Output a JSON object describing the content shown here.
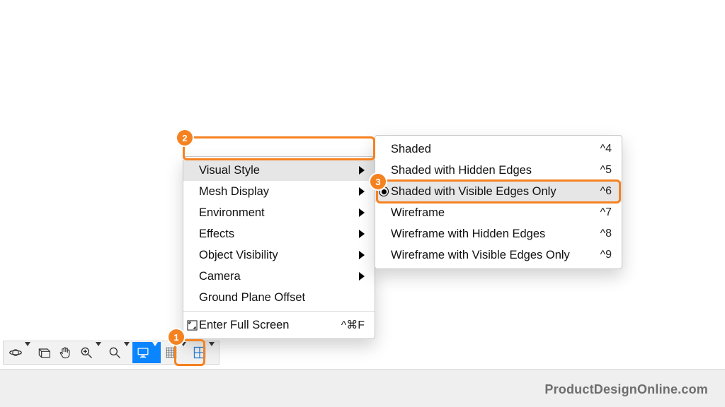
{
  "annotations": {
    "badge1": "1",
    "badge2": "2",
    "badge3": "3"
  },
  "toolbar": {
    "items": [
      {
        "name": "orbit-tool",
        "dropdown": true
      },
      {
        "name": "look-at-tool",
        "dropdown": false
      },
      {
        "name": "pan-tool",
        "dropdown": false
      },
      {
        "name": "zoom-tool",
        "dropdown": true
      },
      {
        "name": "fit-tool",
        "dropdown": true
      },
      {
        "name": "display-settings-tool",
        "dropdown": true,
        "selected": true
      },
      {
        "name": "grid-tool",
        "dropdown": true
      },
      {
        "name": "viewports-tool",
        "dropdown": true
      }
    ]
  },
  "menu": {
    "items": [
      {
        "label": "Visual Style",
        "submenu": true,
        "hover": true
      },
      {
        "label": "Mesh Display",
        "submenu": true
      },
      {
        "label": "Environment",
        "submenu": true
      },
      {
        "label": "Effects",
        "submenu": true
      },
      {
        "label": "Object Visibility",
        "submenu": true
      },
      {
        "label": "Camera",
        "submenu": true
      },
      {
        "label": "Ground Plane Offset",
        "submenu": false
      }
    ],
    "fullscreen": {
      "label": "Enter Full Screen",
      "shortcut": "^⌘F"
    }
  },
  "submenu": {
    "items": [
      {
        "label": "Shaded",
        "shortcut": "^4"
      },
      {
        "label": "Shaded with Hidden Edges",
        "shortcut": "^5"
      },
      {
        "label": "Shaded with Visible Edges Only",
        "shortcut": "^6",
        "hover": true,
        "selected": true
      },
      {
        "label": "Wireframe",
        "shortcut": "^7"
      },
      {
        "label": "Wireframe with Hidden Edges",
        "shortcut": "^8"
      },
      {
        "label": "Wireframe with Visible Edges Only",
        "shortcut": "^9"
      }
    ]
  },
  "watermark": "ProductDesignOnline.com"
}
